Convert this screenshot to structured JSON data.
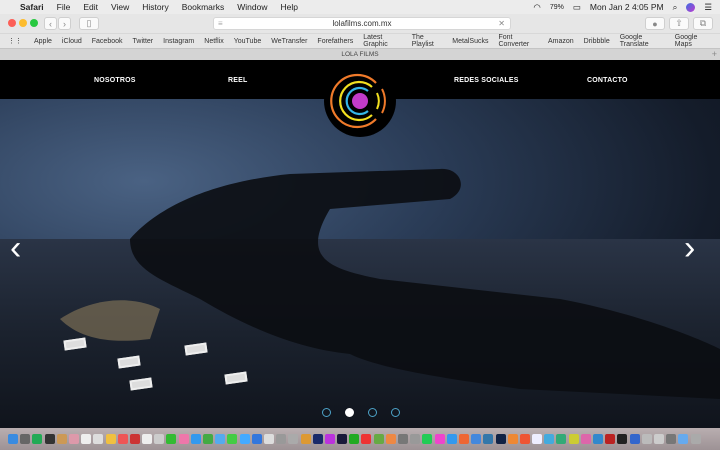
{
  "menubar": {
    "app": "Safari",
    "items": [
      "File",
      "Edit",
      "View",
      "History",
      "Bookmarks",
      "Window",
      "Help"
    ],
    "battery": "79%",
    "clock": "Mon Jan 2  4:05 PM"
  },
  "toolbar": {
    "url": "lolafilms.com.mx"
  },
  "bookmarks": [
    "Apple",
    "iCloud",
    "Facebook",
    "Twitter",
    "Instagram",
    "Netflix",
    "YouTube",
    "WeTransfer",
    "Forefathers",
    "Latest Graphic",
    "The Playlist",
    "MetalSucks",
    "Font Converter",
    "Amazon",
    "Dribbble",
    "Google Translate",
    "Google Maps"
  ],
  "tab": {
    "title": "LOLA FILMS"
  },
  "site": {
    "nav": [
      "NOSOTROS",
      "REEL",
      "REDES SOCIALES",
      "CONTACTO"
    ],
    "slides": 4,
    "active_slide": 2
  },
  "colors": {
    "accent": "#4da3c8"
  }
}
